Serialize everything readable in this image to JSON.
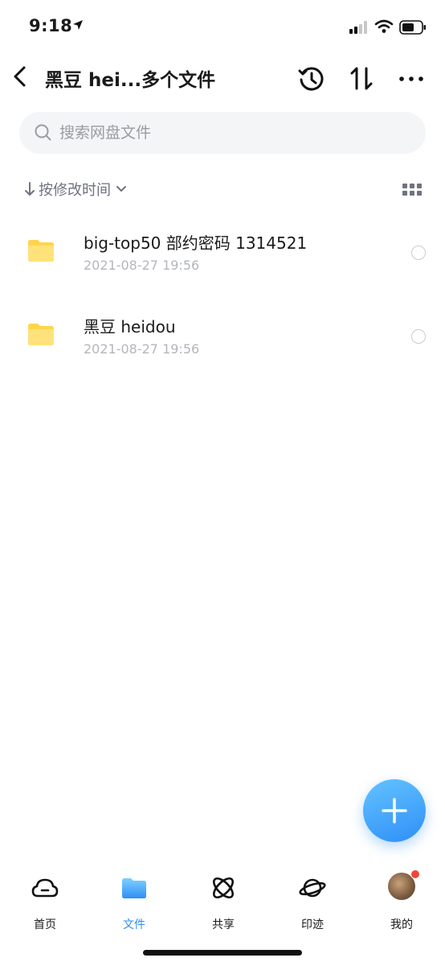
{
  "status": {
    "time": "9:18"
  },
  "nav": {
    "title": "黑豆 hei...多个文件"
  },
  "search": {
    "placeholder": "搜索网盘文件"
  },
  "sort": {
    "label": "按修改时间"
  },
  "files": [
    {
      "name": "big-top50 部约密码 1314521",
      "date": "2021-08-27 19:56",
      "icon": "folder-icon"
    },
    {
      "name": "黑豆 heidou",
      "date": "2021-08-27 19:56",
      "icon": "folder-icon"
    }
  ],
  "tabs": [
    {
      "label": "首页",
      "icon": "cloud-icon",
      "active": false
    },
    {
      "label": "文件",
      "icon": "folder-icon",
      "active": true
    },
    {
      "label": "共享",
      "icon": "atom-icon",
      "active": false
    },
    {
      "label": "印迹",
      "icon": "planet-icon",
      "active": false
    },
    {
      "label": "我的",
      "icon": "avatar",
      "active": false
    }
  ],
  "colors": {
    "accent": "#2e8ff5",
    "folder": "#ffd54a",
    "fab_start": "#63c3ff",
    "fab_end": "#2f8ff7",
    "badge": "#f0453a"
  }
}
